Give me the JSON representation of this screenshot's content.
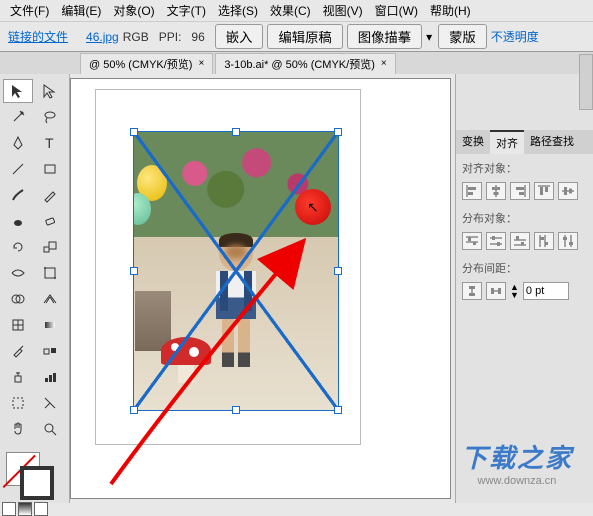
{
  "menubar": {
    "file": "文件(F)",
    "edit": "编辑(E)",
    "object": "对象(O)",
    "type": "文字(T)",
    "select": "选择(S)",
    "effect": "效果(C)",
    "view": "视图(V)",
    "window": "窗口(W)",
    "help": "帮助(H)"
  },
  "controlbar": {
    "linked_file": "链接的文件",
    "filename": "46.jpg",
    "colormode": "RGB",
    "ppi_label": "PPI:",
    "ppi_value": "96",
    "embed": "嵌入",
    "edit_original": "编辑原稿",
    "image_trace": "图像描摹",
    "mask": "蒙版",
    "opacity": "不透明度"
  },
  "tabs": {
    "tab1": "@ 50% (CMYK/预览)",
    "tab2": "3-10b.ai* @ 50% (CMYK/预览)"
  },
  "panels": {
    "transform": "变换",
    "align": "对齐",
    "pathfinder": "路径查找",
    "align_objects_label": "对齐对象：",
    "distribute_objects_label": "分布对象：",
    "distribute_spacing_label": "分布间距：",
    "spacing_value": "0 pt"
  },
  "watermark": {
    "title": "下载之家",
    "url": "www.downza.cn"
  }
}
